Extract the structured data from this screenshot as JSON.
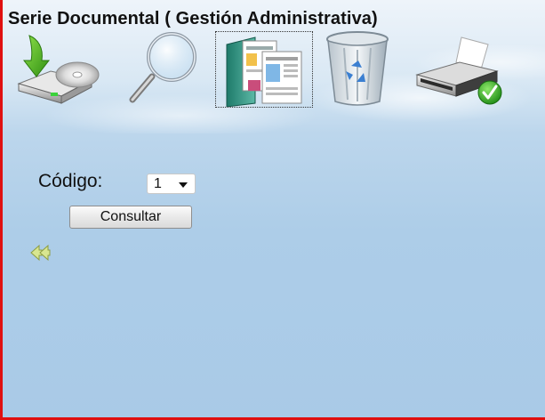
{
  "window": {
    "title": "Serie Documental ( Gestión Administrativa)"
  },
  "toolbar": {
    "items": [
      {
        "icon": "save-disk-icon",
        "selected": false
      },
      {
        "icon": "search-magnifier-icon",
        "selected": false
      },
      {
        "icon": "document-series-icon",
        "selected": true
      },
      {
        "icon": "recycle-bin-icon",
        "selected": false
      },
      {
        "icon": "printer-icon",
        "selected": false
      }
    ]
  },
  "form": {
    "code_label": "Código:",
    "code_value": "1",
    "submit_label": "Consultar"
  },
  "navigation": {
    "back_icon": "double-left-arrow-icon"
  },
  "colors": {
    "frame_border": "#e01010",
    "background": "#a9cae7",
    "back_arrow": "#d8e690"
  }
}
